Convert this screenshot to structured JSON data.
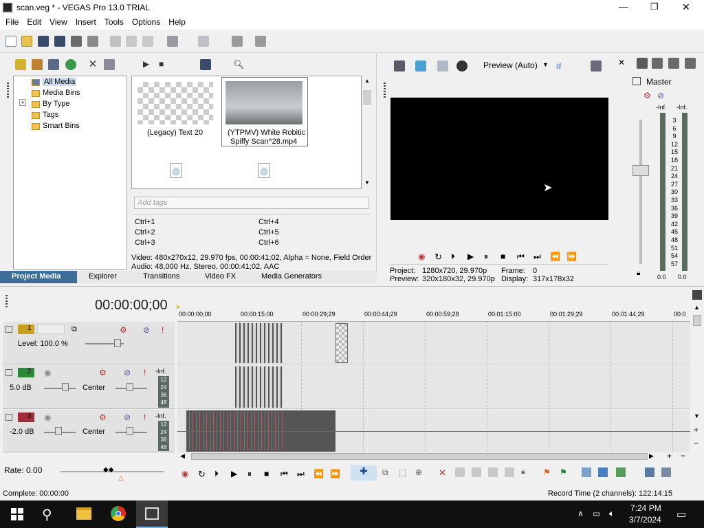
{
  "window": {
    "title": "scan.veg * - VEGAS Pro 13.0 TRIAL",
    "minimize": "—",
    "maximize": "❐",
    "close": "✕"
  },
  "menu": [
    "File",
    "Edit",
    "View",
    "Insert",
    "Tools",
    "Options",
    "Help"
  ],
  "media_tree": {
    "items": [
      "All Media",
      "Media Bins",
      "By Type",
      "Tags",
      "Smart Bins"
    ],
    "expand": "+"
  },
  "media_grid": {
    "items": [
      {
        "label": "(Legacy) Text 20"
      },
      {
        "label_line1": "(YTPMV) White Robitic",
        "label_line2": "Spiffy Scan^28.mp4"
      }
    ]
  },
  "tags": {
    "placeholder": "Add tags",
    "shortcuts": [
      "Ctrl+1",
      "Ctrl+2",
      "Ctrl+3",
      "Ctrl+4",
      "Ctrl+5",
      "Ctrl+6"
    ]
  },
  "media_info": {
    "video": "Video: 480x270x12, 29.970 fps, 00:00:41;02, Alpha = None, Field Order",
    "audio": "Audio: 48,000 Hz, Stereo, 00:00:41;02, AAC"
  },
  "panel_tabs": [
    "Project Media",
    "Explorer",
    "Transitions",
    "Video FX",
    "Media Generators"
  ],
  "preview": {
    "mode": "Preview (Auto)",
    "project_label": "Project:",
    "project_value": "1280x720, 29.970p",
    "frame_label": "Frame:",
    "frame_value": "0",
    "preview_label": "Preview:",
    "preview_value": "320x180x32, 29.970p",
    "display_label": "Display:",
    "display_value": "317x178x32"
  },
  "master": {
    "title": "Master",
    "inf_left": "-Inf.",
    "inf_right": "-Inf.",
    "scale": [
      "3",
      "6",
      "9",
      "12",
      "15",
      "18",
      "21",
      "24",
      "27",
      "30",
      "33",
      "36",
      "39",
      "42",
      "45",
      "48",
      "51",
      "54",
      "57"
    ],
    "bottom_left": "0.0",
    "bottom_right": "0.0"
  },
  "timeline": {
    "timecode": "00:00:00;00",
    "ruler": [
      "00:00:00;00",
      "00:00:15:00",
      "00:00:29;29",
      "00:00:44;29",
      "00:00:59;28",
      "00:01:15:00",
      "00:01:29;29",
      "00:01:44;29",
      "00:0"
    ],
    "tracks": [
      {
        "num": "1",
        "type": "video",
        "level": "Level: 100.0 %"
      },
      {
        "num": "2",
        "type": "audio",
        "volume": "5.0 dB",
        "pan": "Center",
        "inf": "-Inf.",
        "meter": [
          "12",
          "24",
          "36",
          "48"
        ]
      },
      {
        "num": "3",
        "type": "audio",
        "volume": "-2.0 dB",
        "pan": "Center",
        "inf": "-Inf.",
        "meter": [
          "12",
          "24",
          "36",
          "48"
        ]
      }
    ]
  },
  "rate": "Rate: 0.00",
  "status": {
    "left": "Complete: 00:00:00",
    "right": "Record Time (2 channels): 122:14:15"
  },
  "taskbar": {
    "time": "7:24 PM",
    "date": "3/7/2024"
  },
  "colors": {
    "accent": "#3c6e99",
    "track1": "#c8a020",
    "track2": "#2a8a3a",
    "track3": "#a02c3c",
    "video_bg": "#000000"
  }
}
